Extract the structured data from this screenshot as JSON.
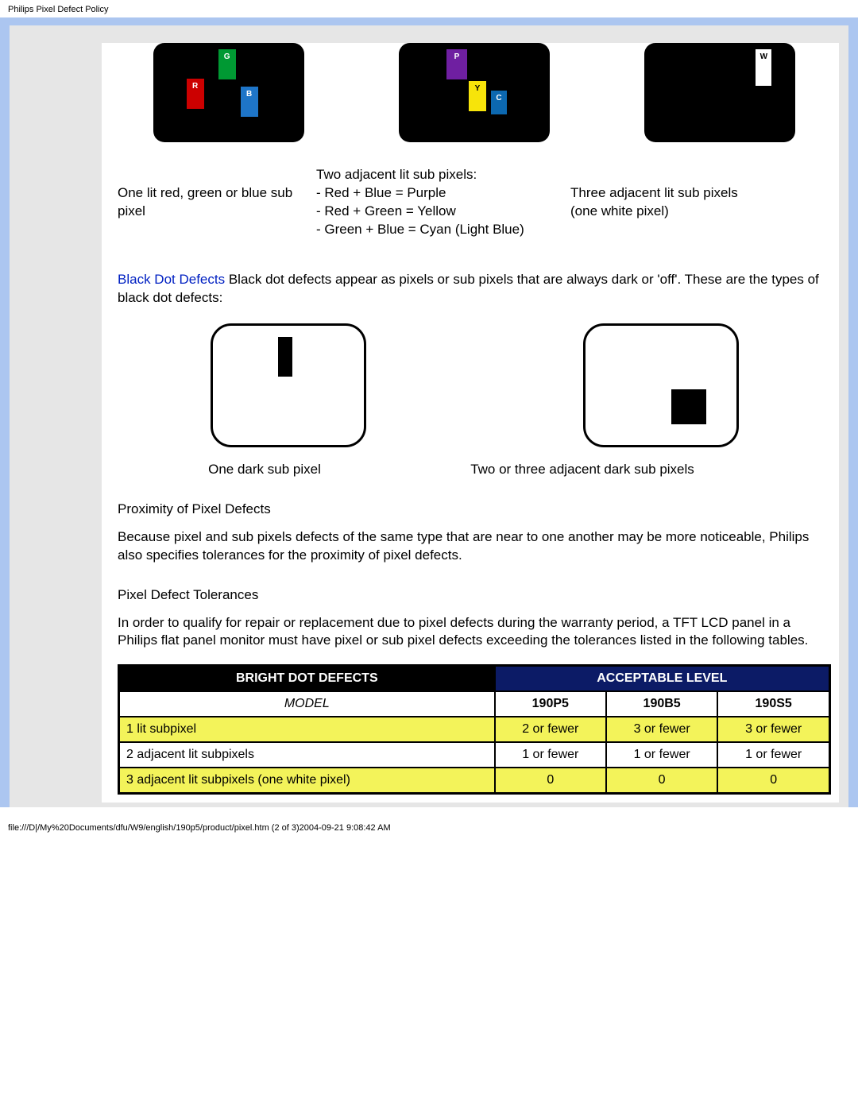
{
  "page_header": "Philips Pixel Defect Policy",
  "monitors": {
    "rgb": {
      "G": "G",
      "R": "R",
      "B": "B"
    },
    "pyc": {
      "P": "P",
      "Y": "Y",
      "C": "C"
    },
    "w": {
      "W": "W"
    }
  },
  "captions": {
    "one_lit": "One lit red, green or blue sub pixel",
    "two_adj_title": "Two adjacent lit sub pixels:",
    "two_adj_l1": "- Red + Blue = Purple",
    "two_adj_l2": "- Red + Green = Yellow",
    "two_adj_l3": "- Green + Blue = Cyan (Light Blue)",
    "three_adj": "Three adjacent lit sub pixels (one white pixel)"
  },
  "black_dot": {
    "term": "Black Dot Defects",
    "text": " Black dot defects appear as pixels or sub pixels that are always dark or 'off'. These are the types of black dot defects:"
  },
  "dark_caps": {
    "one": "One dark sub pixel",
    "two": "Two or three adjacent dark sub pixels"
  },
  "proximity": {
    "title": "Proximity of Pixel Defects",
    "text": "Because pixel and sub pixels defects of the same type that are near to one another may be more noticeable, Philips also specifies tolerances for the proximity of pixel defects."
  },
  "tolerances": {
    "title": "Pixel Defect Tolerances",
    "text": "In order to qualify for repair or replacement due to pixel defects during the warranty period, a TFT LCD panel in a Philips flat panel monitor must have pixel or sub pixel defects exceeding the tolerances listed in the following tables."
  },
  "chart_data": {
    "type": "table",
    "title_left": "BRIGHT DOT DEFECTS",
    "title_right": "ACCEPTABLE LEVEL",
    "model_label": "MODEL",
    "models": [
      "190P5",
      "190B5",
      "190S5"
    ],
    "rows": [
      {
        "label": "1 lit subpixel",
        "values": [
          "2 or fewer",
          "3 or fewer",
          "3 or fewer"
        ],
        "highlight": true
      },
      {
        "label": "2 adjacent lit subpixels",
        "values": [
          "1 or fewer",
          "1 or fewer",
          "1 or fewer"
        ],
        "highlight": false
      },
      {
        "label": "3 adjacent lit subpixels (one white pixel)",
        "values": [
          "0",
          "0",
          "0"
        ],
        "highlight": true
      }
    ]
  },
  "footer": "file:///D|/My%20Documents/dfu/W9/english/190p5/product/pixel.htm (2 of 3)2004-09-21 9:08:42 AM"
}
